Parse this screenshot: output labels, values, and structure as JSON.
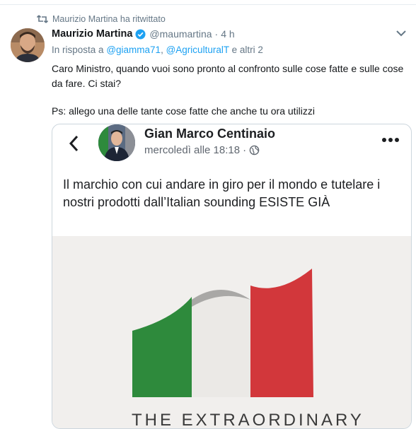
{
  "retweet": {
    "label": "Maurizio Martina ha ritwittato",
    "icon": "retweet-icon"
  },
  "tweet": {
    "author_name": "Maurizio Martina",
    "verified_icon": "verified-badge-icon",
    "handle": "@maumartina",
    "separator": "·",
    "time": "4 h",
    "reply_prefix": "In risposta a",
    "reply_user1": "@giamma71",
    "reply_comma": ",",
    "reply_user2": "@AgriculturalT",
    "reply_suffix": "e altri 2",
    "text_line1": "Caro Ministro, quando vuoi sono pronto al confronto sulle cose fatte e sulle cose",
    "text_line2": "da fare. Ci stai?",
    "text_ps": "Ps: allego una delle tante cose fatte che anche tu ora utilizzi",
    "menu_icon": "chevron-down-icon"
  },
  "embedded_post": {
    "author_name": "Gian Marco Centinaio",
    "timestamp": "mercoledì alle 18:18",
    "separator": "·",
    "privacy_icon": "globe-icon",
    "text": "Il marchio con cui andare in giro per il mondo e tutelare i nostri prodotti dall’Italian sounding ESISTE GIÀ",
    "image_caption": "THE EXTRAORDINARY",
    "colors": {
      "green": "#2e8a3c",
      "white": "#ebe9e6",
      "red": "#d2373b",
      "gray": "#a9a8a6"
    }
  }
}
